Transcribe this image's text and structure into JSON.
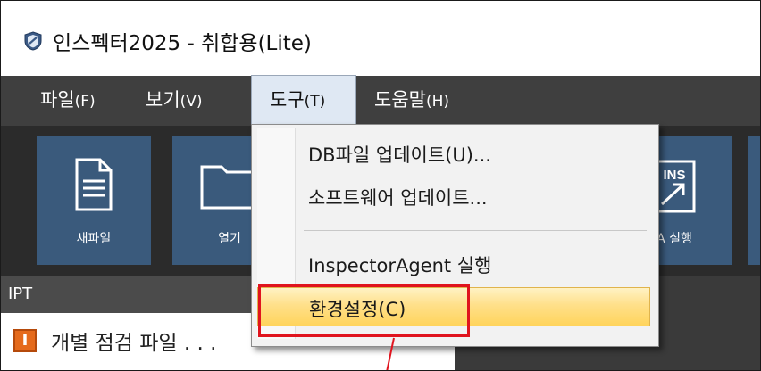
{
  "window": {
    "title": "인스펙터2025 - 취합용(Lite)",
    "icon": "shield-icon"
  },
  "menubar": {
    "items": [
      {
        "label": "파일",
        "mnemonic": "(F)"
      },
      {
        "label": "보기",
        "mnemonic": "(V)"
      },
      {
        "label": "도구",
        "mnemonic": "(T)"
      },
      {
        "label": "도움말",
        "mnemonic": "(H)"
      }
    ],
    "active_index": 2
  },
  "toolbar": {
    "buttons": [
      {
        "label": "새파일",
        "icon": "new-file-icon"
      },
      {
        "label": "열기",
        "icon": "open-folder-icon"
      },
      {
        "label": "A 실행",
        "icon": "ins-run-icon",
        "badge": "INS"
      }
    ]
  },
  "dropdown": {
    "items": [
      {
        "label": "DB파일 업데이트(U)..."
      },
      {
        "label": "소프트웨어 업데이트..."
      },
      {
        "label": "InspectorAgent 실행"
      },
      {
        "label": "환경설정(C)"
      }
    ],
    "highlighted_index": 3
  },
  "panel": {
    "tab_label": "IPT",
    "item_icon_letter": "I",
    "item_label": "개별 점검 파일 . . ."
  },
  "colors": {
    "menubar_bg": "#3f3f3f",
    "toolbar_tile": "#3a5a7c",
    "highlight": "#ffd45c",
    "callout": "#e0141e"
  }
}
